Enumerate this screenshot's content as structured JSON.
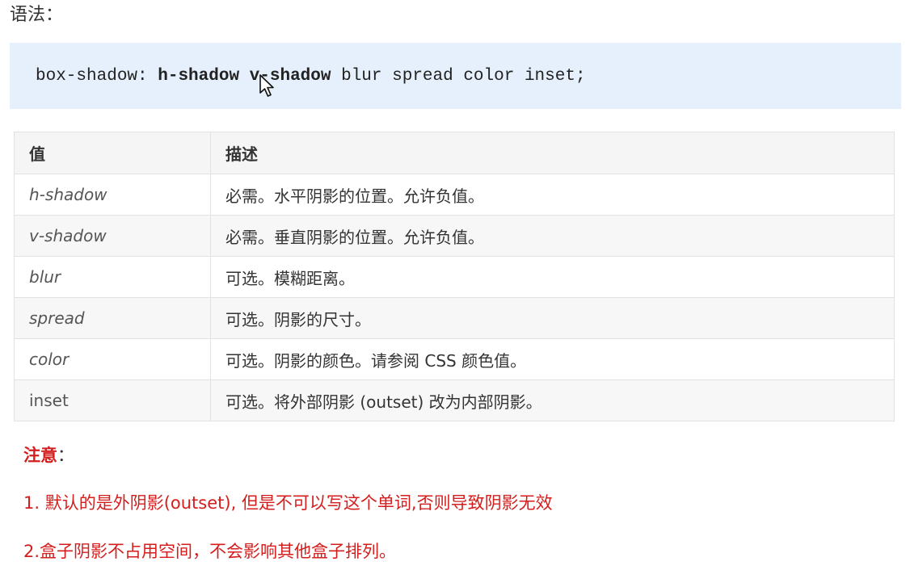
{
  "syntax_heading": "语法：",
  "code": {
    "prefix": "box-shadow: ",
    "h_shadow": "h-shadow",
    "v_shadow": "v-shadow",
    "rest": " blur spread color inset;"
  },
  "table": {
    "headers": [
      "值",
      "描述"
    ],
    "rows": [
      {
        "value": "h-shadow",
        "description": "必需。水平阴影的位置。允许负值。"
      },
      {
        "value": "v-shadow",
        "description": "必需。垂直阴影的位置。允许负值。"
      },
      {
        "value": "blur",
        "description": "可选。模糊距离。"
      },
      {
        "value": "spread",
        "description": "可选。阴影的尺寸。"
      },
      {
        "value": "color",
        "description": "可选。阴影的颜色。请参阅 CSS 颜色值。"
      },
      {
        "value": "inset",
        "description": "可选。将外部阴影 (outset) 改为内部阴影。"
      }
    ]
  },
  "note": {
    "title": "注意",
    "colon": "：",
    "lines": [
      "1. 默认的是外阴影(outset), 但是不可以写这个单词,否则导致阴影无效",
      "2.盒子阴影不占用空间，不会影响其他盒子排列。"
    ]
  },
  "colors": {
    "code_background": "#e5f0fc",
    "note_red": "#d41e1e",
    "table_border": "#e2e2e2"
  },
  "icons": {
    "cursor": "mouse-pointer-icon"
  }
}
